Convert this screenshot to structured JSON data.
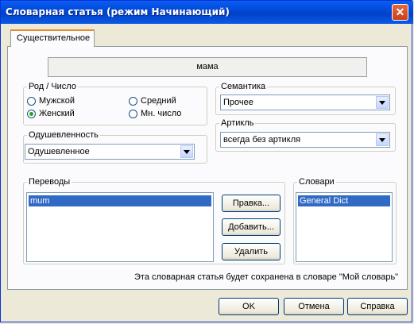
{
  "window": {
    "title": "Словарная статья (режим Начинающий)",
    "close_glyph": "✕"
  },
  "tab": {
    "label": "Существительное"
  },
  "word": "мама",
  "gender_number": {
    "legend": "Род / Число",
    "options": [
      {
        "label": "Мужской",
        "checked": false
      },
      {
        "label": "Женский",
        "checked": true
      },
      {
        "label": "Средний",
        "checked": false
      },
      {
        "label": "Мн. число",
        "checked": false
      }
    ]
  },
  "animacy": {
    "legend": "Одушевленность",
    "value": "Одушевленное"
  },
  "semantics": {
    "legend": "Семантика",
    "value": "Прочее"
  },
  "article": {
    "legend": "Артикль",
    "value": "всегда без артикля"
  },
  "translations": {
    "legend": "Переводы",
    "items": [
      "mum"
    ],
    "buttons": {
      "edit": "Правка...",
      "add": "Добавить...",
      "delete": "Удалить"
    }
  },
  "dictionaries": {
    "legend": "Словари",
    "items": [
      "General Dict"
    ]
  },
  "note": "Эта словарная статья будет сохранена в словаре \"Мой словарь\"",
  "footer": {
    "ok": "OK",
    "cancel": "Отмена",
    "help": "Справка"
  },
  "colors": {
    "title_bar": "#0a5ef2",
    "selection": "#316ac5",
    "radio_checked": "#21a121"
  }
}
